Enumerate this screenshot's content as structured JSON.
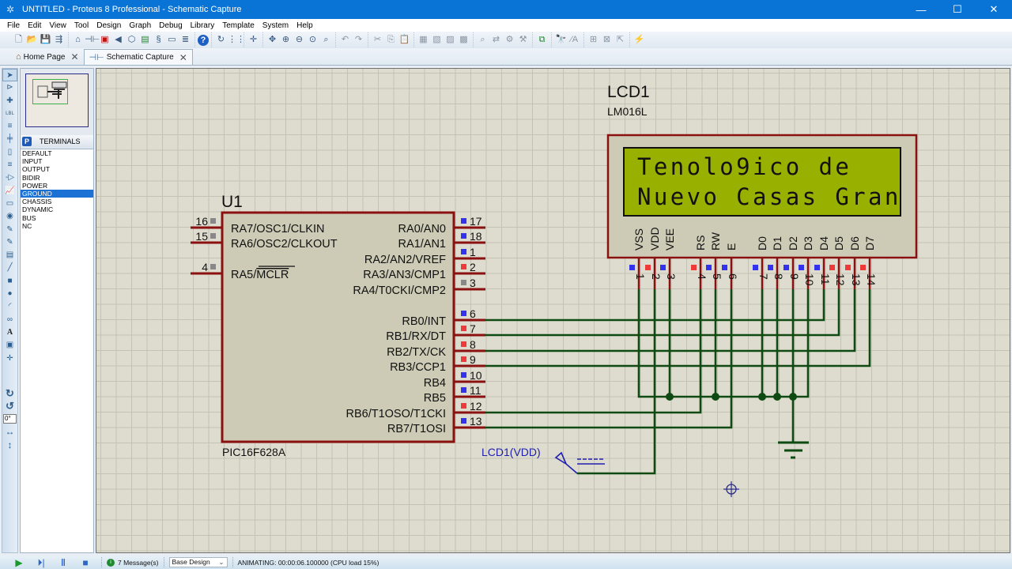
{
  "window": {
    "title": "UNTITLED - Proteus 8 Professional - Schematic Capture",
    "minimize": "—",
    "maximize": "☐",
    "close": "✕"
  },
  "menu": [
    "File",
    "Edit",
    "View",
    "Tool",
    "Design",
    "Graph",
    "Debug",
    "Library",
    "Template",
    "System",
    "Help"
  ],
  "toolbar": {
    "groups": [
      [
        "new-file",
        "open-folder",
        "save",
        "import"
      ],
      [
        "home-page",
        "schematic-capture",
        "pcb-layout",
        "gerber-viewer",
        "3d-visualizer",
        "bill-of-materials",
        "source-code",
        "design-explorer",
        "notes"
      ],
      [
        "help"
      ],
      [
        "refresh",
        "grid-toggle"
      ],
      [
        "origin"
      ],
      [
        "pan",
        "zoom-in",
        "zoom-out",
        "zoom-all",
        "zoom-area"
      ],
      [
        "undo",
        "redo"
      ],
      [
        "cut",
        "copy",
        "paste"
      ],
      [
        "block-copy",
        "block-move",
        "block-rotate",
        "block-delete"
      ],
      [
        "pick-device",
        "make-device",
        "packaging-tool",
        "decompose"
      ],
      [
        "wire-autorouter"
      ],
      [
        "search-tag",
        "property-assignment"
      ],
      [
        "new-sheet",
        "remove-sheet",
        "exit-to-parent"
      ],
      [
        "electrical-rule-check"
      ]
    ]
  },
  "tabs": [
    {
      "label": "Home Page",
      "icon": "home",
      "active": false
    },
    {
      "label": "Schematic Capture",
      "icon": "schematic",
      "active": true
    }
  ],
  "left_tools": [
    "selection",
    "component",
    "junction-dot",
    "wire-label",
    "text-script",
    "bus",
    "sub-circuit",
    "terminals",
    "device-pins",
    "graph",
    "tape-recorder",
    "generator",
    "voltage-probe",
    "current-probe",
    "virtual-instruments",
    "2d-line",
    "2d-box",
    "2d-circle",
    "2d-arc",
    "2d-path",
    "2d-text",
    "2d-symbol",
    "2d-marker"
  ],
  "rotation": {
    "rotate_cw": "rotate-clockwise",
    "rotate_ccw": "rotate-anticlockwise",
    "angle": "0°",
    "mirror_x": "mirror-horizontal",
    "mirror_y": "mirror-vertical"
  },
  "side_panel": {
    "header_badge": "P",
    "header": "TERMINALS",
    "items": [
      "DEFAULT",
      "INPUT",
      "OUTPUT",
      "BIDIR",
      "POWER",
      "GROUND",
      "CHASSIS",
      "DYNAMIC",
      "BUS",
      "NC"
    ],
    "selected": "GROUND"
  },
  "schematic": {
    "mcu": {
      "ref": "U1",
      "part": "PIC16F628A",
      "left_pins": [
        {
          "num": "16",
          "name": "RA7/OSC1/CLKIN",
          "state": "gray"
        },
        {
          "num": "15",
          "name": "RA6/OSC2/CLKOUT",
          "state": "gray"
        },
        {
          "num": "4",
          "name_prefix": "RA5/",
          "name_overbar": "MCLR",
          "state": "gray"
        }
      ],
      "right_pins": [
        {
          "num": "17",
          "name": "RA0/AN0",
          "state": "blue"
        },
        {
          "num": "18",
          "name": "RA1/AN1",
          "state": "blue"
        },
        {
          "num": "1",
          "name": "RA2/AN2/VREF",
          "state": "blue"
        },
        {
          "num": "2",
          "name": "RA3/AN3/CMP1",
          "state": "red"
        },
        {
          "num": "3",
          "name": "RA4/T0CKI/CMP2",
          "state": "gray"
        },
        {
          "num": "6",
          "name": "RB0/INT",
          "state": "blue"
        },
        {
          "num": "7",
          "name": "RB1/RX/DT",
          "state": "red"
        },
        {
          "num": "8",
          "name": "RB2/TX/CK",
          "state": "red"
        },
        {
          "num": "9",
          "name": "RB3/CCP1",
          "state": "red"
        },
        {
          "num": "10",
          "name": "RB4",
          "state": "blue"
        },
        {
          "num": "11",
          "name": "RB5",
          "state": "blue"
        },
        {
          "num": "12",
          "name": "RB6/T1OSO/T1CKI",
          "state": "red"
        },
        {
          "num": "13",
          "name": "RB7/T1OSI",
          "state": "blue"
        }
      ]
    },
    "lcd": {
      "ref": "LCD1",
      "part": "LM016L",
      "line1": "Tenolo9ico de",
      "line2": "Nuevo Casas Gran",
      "pins": [
        {
          "num": "1",
          "name": "VSS",
          "state": "blue"
        },
        {
          "num": "2",
          "name": "VDD",
          "state": "red"
        },
        {
          "num": "3",
          "name": "VEE",
          "state": "blue"
        },
        {
          "num": "4",
          "name": "RS",
          "state": "red"
        },
        {
          "num": "5",
          "name": "RW",
          "state": "blue"
        },
        {
          "num": "6",
          "name": "E",
          "state": "blue"
        },
        {
          "num": "7",
          "name": "D0",
          "state": "blue"
        },
        {
          "num": "8",
          "name": "D1",
          "state": "blue"
        },
        {
          "num": "9",
          "name": "D2",
          "state": "blue"
        },
        {
          "num": "10",
          "name": "D3",
          "state": "blue"
        },
        {
          "num": "11",
          "name": "D4",
          "state": "blue"
        },
        {
          "num": "12",
          "name": "D5",
          "state": "red"
        },
        {
          "num": "13",
          "name": "D6",
          "state": "red"
        },
        {
          "num": "14",
          "name": "D7",
          "state": "red"
        }
      ]
    },
    "power_terminal_label": "LCD1(VDD)",
    "colors": {
      "wire": "#0f4a12",
      "component_border": "#8b1010",
      "component_fill": "#cdcbb5",
      "lcd_screen": "#98b000",
      "pin_high": "#ef3a3a",
      "pin_low": "#3333ee",
      "pin_float": "#888888",
      "label_blue": "#2020b0"
    }
  },
  "status": {
    "play": "play",
    "step": "step",
    "pause": "pause",
    "stop": "stop",
    "messages": "7 Message(s)",
    "design": "Base Design",
    "animating": "ANIMATING: 00:00:06.100000 (CPU load 15%)"
  }
}
